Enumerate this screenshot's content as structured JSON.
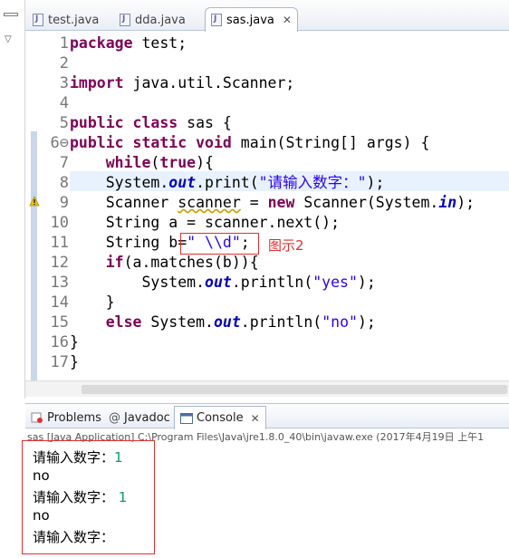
{
  "editor_tabs": [
    {
      "label": "test.java",
      "active": false
    },
    {
      "label": "dda.java",
      "active": false
    },
    {
      "label": "sas.java",
      "active": true
    }
  ],
  "code_lines": [
    {
      "n": "1",
      "t": ""
    },
    {
      "n": "2",
      "t": ""
    },
    {
      "n": "3",
      "t": ""
    },
    {
      "n": "4",
      "t": ""
    },
    {
      "n": "5",
      "t": ""
    },
    {
      "n": "6⊖",
      "t": ""
    },
    {
      "n": "7",
      "t": ""
    },
    {
      "n": "8",
      "t": ""
    },
    {
      "n": "9",
      "t": ""
    },
    {
      "n": "10",
      "t": ""
    },
    {
      "n": "11",
      "t": ""
    },
    {
      "n": "12",
      "t": ""
    },
    {
      "n": "13",
      "t": ""
    },
    {
      "n": "14",
      "t": ""
    },
    {
      "n": "15",
      "t": ""
    },
    {
      "n": "16",
      "t": ""
    },
    {
      "n": "17",
      "t": ""
    }
  ],
  "code": {
    "l1_kw": "package",
    "l1_rest": " test;",
    "l3_kw": "import",
    "l3_rest": " java.util.Scanner;",
    "l5_kw1": "public",
    "l5_kw2": "class",
    "l5_rest": " sas {",
    "l6_kw1": "public",
    "l6_kw2": "static",
    "l6_kw3": "void",
    "l6_rest": " main(String[] args) {",
    "l7_kw": "while",
    "l7_kw2": "true",
    "l7_rest_open": "(",
    "l7_rest_close": "){",
    "l8_a": "System.",
    "l8_fld": "out",
    "l8_b": ".print(",
    "l8_str": "\"请输入数字：\"",
    "l8_c": ");",
    "l9_a": "Scanner ",
    "l9_warn": "scanner",
    "l9_b": " = ",
    "l9_kw": "new",
    "l9_c": " Scanner(System.",
    "l9_fld": "in",
    "l9_d": ");",
    "l10": "String a = scanner.next();",
    "l11_a": "String b=",
    "l11_str": "\" \\\\d\"",
    "l11_b": ";",
    "l12_kw": "if",
    "l12_rest": "(a.matches(b)){",
    "l13_a": "System.",
    "l13_fld": "out",
    "l13_b": ".println(",
    "l13_str": "\"yes\"",
    "l13_c": ");",
    "l14": "}",
    "l15_kw": "else",
    "l15_a": " System.",
    "l15_fld": "out",
    "l15_b": ".println(",
    "l15_str": "\"no\"",
    "l15_c": ");",
    "l16": "}",
    "l17": "}"
  },
  "annotation_label": "图示2",
  "console_tabs": [
    {
      "label": "Problems",
      "icon": "problems-icon",
      "active": false
    },
    {
      "label": "Javadoc",
      "icon": "at-icon",
      "active": false
    },
    {
      "label": "Console",
      "icon": "console-icon",
      "active": true
    }
  ],
  "console_status": "sas [Java Application] C:\\Program Files\\Java\\jre1.8.0_40\\bin\\javaw.exe (2017年4月19日 上午1",
  "console_lines": {
    "p1": "请输入数字：",
    "i1": "1",
    "o1": "no",
    "p2": "请输入数字：",
    "i2": " 1",
    "o2": "no",
    "p3": "请输入数字："
  },
  "colors": {
    "keyword": "#7f0055",
    "string": "#2a00ff",
    "field": "#0000c0",
    "annotation": "#e03030",
    "console_input": "#00a26a"
  }
}
